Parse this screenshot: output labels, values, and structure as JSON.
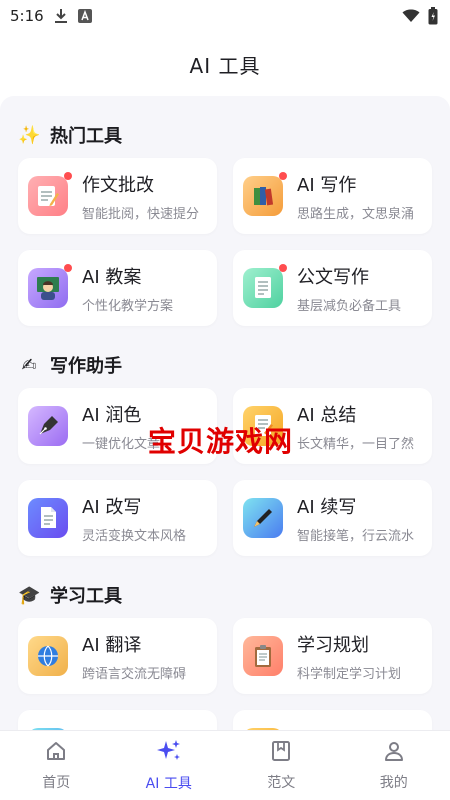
{
  "status_bar": {
    "time": "5:16",
    "icons": [
      "download-icon",
      "a-badge-icon",
      "wifi-icon",
      "battery-icon"
    ]
  },
  "header": {
    "title": "AI 工具"
  },
  "sections": [
    {
      "emoji": "✨",
      "title": "热门工具",
      "items": [
        {
          "name": "作文批改",
          "desc": "智能批阅，快速提分",
          "icon": "memo-icon",
          "badge": true
        },
        {
          "name": "AI 写作",
          "desc": "思路生成，文思泉涌",
          "icon": "books-icon",
          "badge": true
        },
        {
          "name": "AI 教案",
          "desc": "个性化教学方案",
          "icon": "teacher-icon",
          "badge": true
        },
        {
          "name": "公文写作",
          "desc": "基层减负必备工具",
          "icon": "document-icon",
          "badge": true
        }
      ]
    },
    {
      "emoji": "✍",
      "title": "写作助手",
      "items": [
        {
          "name": "AI 润色",
          "desc": "一键优化文章",
          "icon": "fountain-pen-icon",
          "badge": false
        },
        {
          "name": "AI 总结",
          "desc": "长文精华，一目了然",
          "icon": "summary-icon",
          "badge": false
        },
        {
          "name": "AI 改写",
          "desc": "灵活变换文本风格",
          "icon": "page-icon",
          "badge": false
        },
        {
          "name": "AI 续写",
          "desc": "智能接笔，行云流水",
          "icon": "pen-icon",
          "badge": false
        }
      ]
    },
    {
      "emoji": "🎓",
      "title": "学习工具",
      "items": [
        {
          "name": "AI 翻译",
          "desc": "跨语言交流无障碍",
          "icon": "globe-icon",
          "badge": false
        },
        {
          "name": "学习规划",
          "desc": "科学制定学习计划",
          "icon": "clipboard-icon",
          "badge": false
        },
        {
          "name": "",
          "desc": "",
          "icon": "partial-icon-blue",
          "badge": false
        },
        {
          "name": "",
          "desc": "",
          "icon": "partial-icon-orange",
          "badge": false
        }
      ]
    }
  ],
  "watermark": "宝贝游戏网",
  "bottom_nav": [
    {
      "label": "首页",
      "icon": "home-icon",
      "active": false
    },
    {
      "label": "AI 工具",
      "icon": "sparkle-icon",
      "active": true
    },
    {
      "label": "范文",
      "icon": "bookmark-book-icon",
      "active": false
    },
    {
      "label": "我的",
      "icon": "person-icon",
      "active": false
    }
  ],
  "colors": {
    "accent": "#4a4df0",
    "badge": "#ff4d4f",
    "background": "#f6f6fa",
    "watermark": "#e00000"
  }
}
